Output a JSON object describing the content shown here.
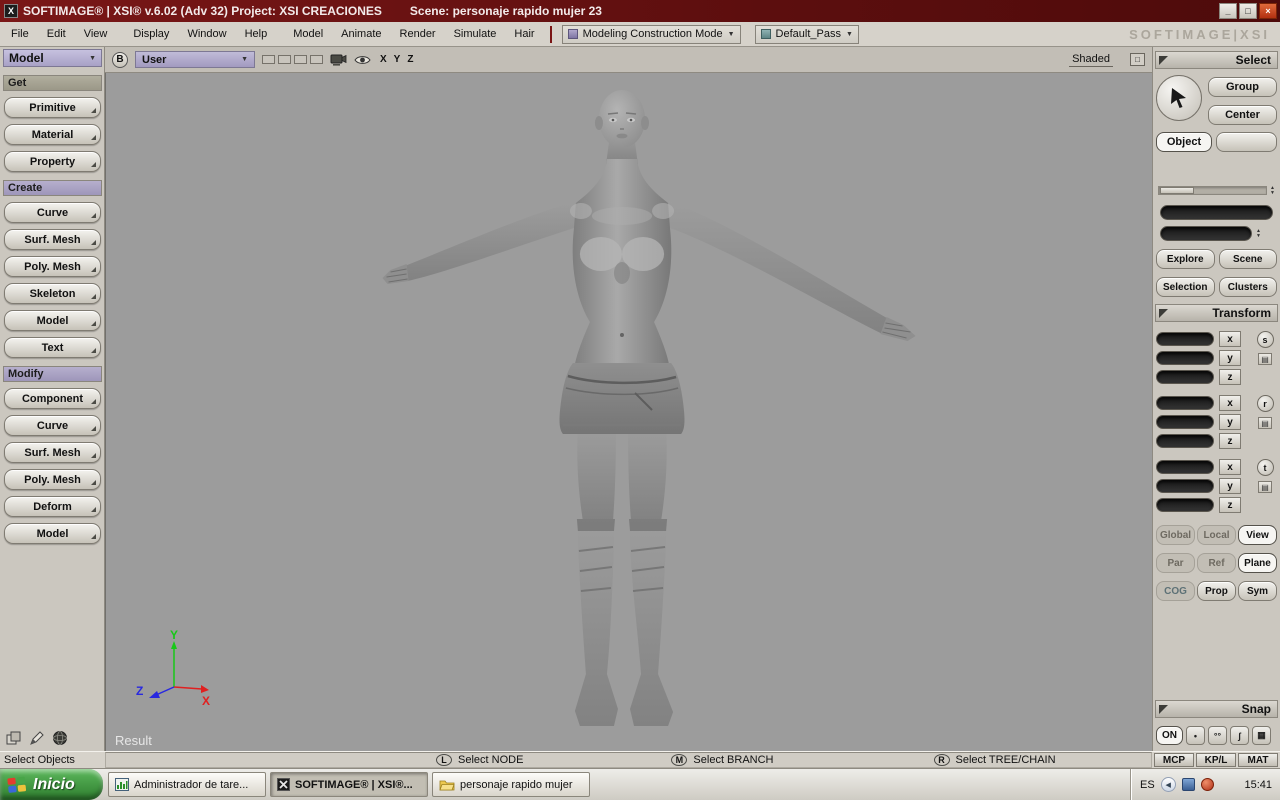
{
  "icons": {
    "down": "▼",
    "up": "▲",
    "left": "◀",
    "minimize": "_",
    "restore": "□",
    "close": "×",
    "list": "▤",
    "dot": "•",
    "pearls": "°°",
    "curve": "ʃ",
    "grid": "▦",
    "app": "X"
  },
  "titlebar": {
    "title": "SOFTIMAGE® | XSI® v.6.02 (Adv 32) Project: XSI CREACIONES",
    "scene": "Scene: personaje rapido mujer 23"
  },
  "menubar": {
    "menus": [
      "File",
      "Edit",
      "View",
      "Display",
      "Window",
      "Help"
    ],
    "app_menus": [
      "Model",
      "Animate",
      "Render",
      "Simulate",
      "Hair"
    ],
    "construction_mode": "Modeling Construction Mode",
    "pass": "Default_Pass",
    "brand": "SOFTIMAGE|XSI"
  },
  "left_panel": {
    "mode": "Model",
    "groups": [
      {
        "header": "Get",
        "items": [
          "Primitive",
          "Material",
          "Property"
        ]
      },
      {
        "header": "Create",
        "items": [
          "Curve",
          "Surf. Mesh",
          "Poly. Mesh",
          "Skeleton",
          "Model",
          "Text"
        ]
      },
      {
        "header": "Modify",
        "items": [
          "Component",
          "Curve",
          "Surf. Mesh",
          "Poly. Mesh",
          "Deform",
          "Model"
        ]
      }
    ]
  },
  "viewport": {
    "b_button": "B",
    "camera": "User",
    "axis_letters": [
      "X",
      "Y",
      "Z"
    ],
    "shading": "Shaded",
    "result": "Result",
    "axes": {
      "x": "X",
      "y": "Y",
      "z": "Z"
    }
  },
  "select_panel": {
    "title": "Select",
    "group": "Group",
    "center": "Center",
    "object": "Object",
    "explore": "Explore",
    "scene": "Scene",
    "selection": "Selection",
    "clusters": "Clusters"
  },
  "transform_panel": {
    "title": "Transform",
    "axis_labels": [
      "x",
      "y",
      "z"
    ],
    "srt": [
      "s",
      "r",
      "t"
    ],
    "space_buttons": [
      "Global",
      "Local",
      "View"
    ],
    "ref_buttons": [
      "Par",
      "Ref",
      "Plane"
    ],
    "opt_buttons": [
      "COG",
      "Prop",
      "Sym"
    ]
  },
  "snap_panel": {
    "title": "Snap",
    "on": "ON"
  },
  "bottom_tabs": [
    "MCP",
    "KP/L",
    "MAT"
  ],
  "statusbar": {
    "left": "Select Objects",
    "hints": [
      {
        "key": "L",
        "label": "Select NODE"
      },
      {
        "key": "M",
        "label": "Select BRANCH"
      },
      {
        "key": "R",
        "label": "Select TREE/CHAIN"
      }
    ]
  },
  "taskbar": {
    "start": "Inicio",
    "tasks": [
      {
        "label": "Administrador de tare..."
      },
      {
        "label": "SOFTIMAGE® | XSI®..."
      },
      {
        "label": "personaje rapido mujer"
      }
    ],
    "tray": {
      "lang": "ES",
      "time": "15:41"
    }
  }
}
